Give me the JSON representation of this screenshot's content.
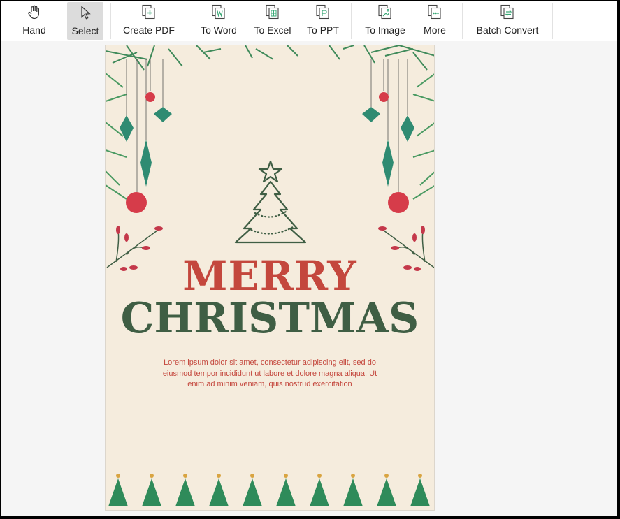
{
  "toolbar": {
    "items": [
      {
        "label": "Hand",
        "icon": "hand-icon"
      },
      {
        "label": "Select",
        "icon": "cursor-icon"
      },
      {
        "label": "Create PDF",
        "icon": "create-pdf-icon"
      },
      {
        "label": "To Word",
        "icon": "word-icon"
      },
      {
        "label": "To Excel",
        "icon": "excel-icon"
      },
      {
        "label": "To PPT",
        "icon": "ppt-icon"
      },
      {
        "label": "To Image",
        "icon": "image-icon"
      },
      {
        "label": "More",
        "icon": "more-icon"
      },
      {
        "label": "Batch Convert",
        "icon": "batch-convert-icon"
      }
    ],
    "active": "Select",
    "accent_color": "#3aa876"
  },
  "document": {
    "title_line1": "MERRY",
    "title_line2": "CHRISTMAS",
    "body": "Lorem ipsum dolor sit amet, consectetur adipiscing elit, sed do eiusmod tempor incididunt ut labore et dolore magna aliqua. Ut enim ad minim veniam, quis nostrud exercitation",
    "colors": {
      "red": "#c4473d",
      "green": "#3f5e44",
      "paper": "#f5ecdd"
    }
  }
}
